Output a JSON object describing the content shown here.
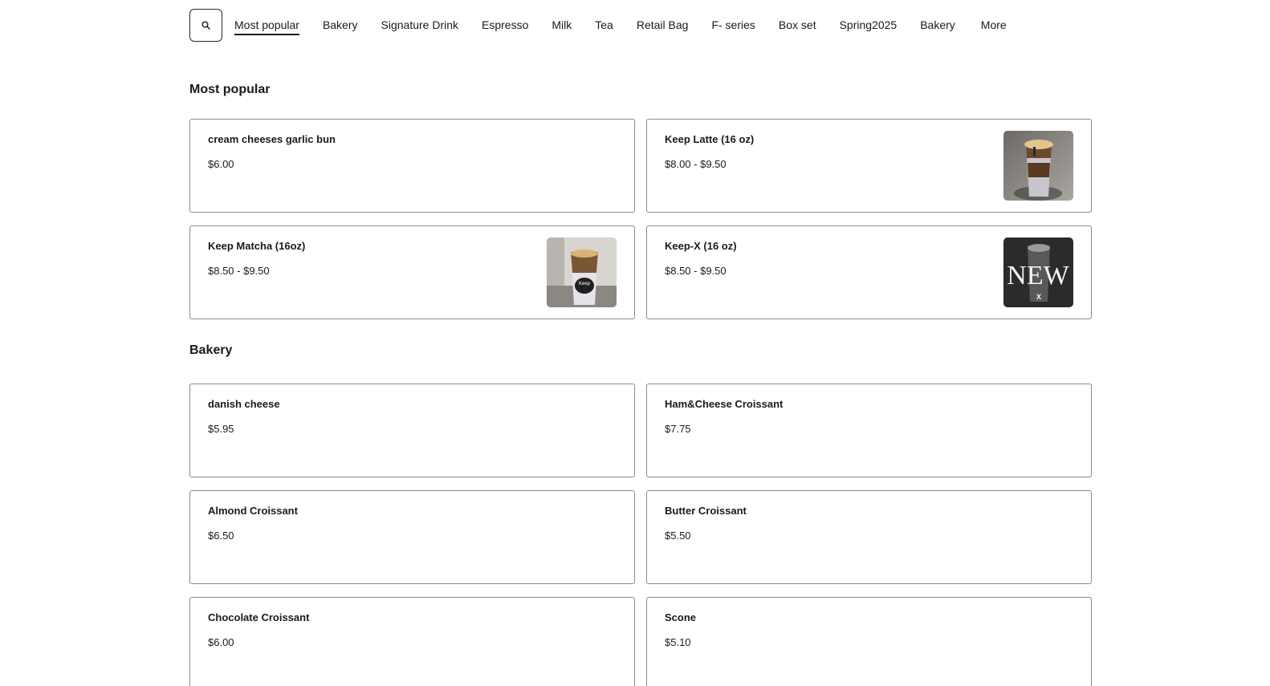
{
  "nav": {
    "search_icon": "search-icon",
    "items": [
      {
        "label": "Most popular",
        "active": true
      },
      {
        "label": "Bakery"
      },
      {
        "label": "Signature Drink"
      },
      {
        "label": "Espresso"
      },
      {
        "label": "Milk"
      },
      {
        "label": "Tea"
      },
      {
        "label": "Retail Bag"
      },
      {
        "label": "F- series"
      },
      {
        "label": "Box set"
      },
      {
        "label": "Spring2025"
      },
      {
        "label": "Bakery"
      }
    ],
    "more_label": "More"
  },
  "sections": {
    "popular": {
      "title": "Most popular",
      "items": [
        {
          "name": "cream cheeses garlic bun",
          "price": "$6.00"
        },
        {
          "name": "Keep Latte (16 oz)",
          "price": "$8.00 - $9.50"
        },
        {
          "name": "Keep Matcha (16oz)",
          "price": "$8.50 - $9.50"
        },
        {
          "name": "Keep-X (16 oz)",
          "price": "$8.50 - $9.50"
        }
      ]
    },
    "bakery": {
      "title": "Bakery",
      "items": [
        {
          "name": "danish cheese",
          "price": "$5.95"
        },
        {
          "name": "Ham&Cheese Croissant",
          "price": "$7.75"
        },
        {
          "name": "Almond Croissant",
          "price": "$6.50"
        },
        {
          "name": "Butter Croissant",
          "price": "$5.50"
        },
        {
          "name": "Chocolate Croissant",
          "price": "$6.00"
        },
        {
          "name": "Scone",
          "price": "$5.10"
        }
      ]
    }
  },
  "thumb_text": {
    "matcha_cup": "Keep",
    "keepx_banner": "NEW",
    "keepx_mark": "X"
  },
  "colors": {
    "text": "#1a1a1a",
    "border": "#8a8a8a",
    "background": "#ffffff"
  }
}
